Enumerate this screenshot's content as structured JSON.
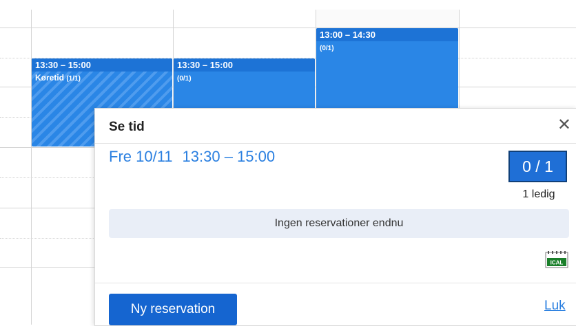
{
  "calendar": {
    "events": [
      {
        "time": "13:30 – 15:00",
        "title": "Køretid",
        "count": "(1/1)"
      },
      {
        "time": "13:30 – 15:00",
        "title": "",
        "count": "(0/1)"
      },
      {
        "time": "13:00 – 14:30",
        "title": "",
        "count": "(0/1)"
      }
    ]
  },
  "modal": {
    "title": "Se tid",
    "close_glyph": "✕",
    "day": "Fre 10/11",
    "time_range": "13:30 – 15:00",
    "capacity": "0 / 1",
    "free_text": "1 ledig",
    "empty_text": "Ingen reservationer endnu",
    "ical_label": "ICAL",
    "new_button": "Ny reservation",
    "close_link": "Luk"
  },
  "colors": {
    "accent": "#2a86e6",
    "primary_button": "#1565d0",
    "link": "#2a7fe0"
  }
}
